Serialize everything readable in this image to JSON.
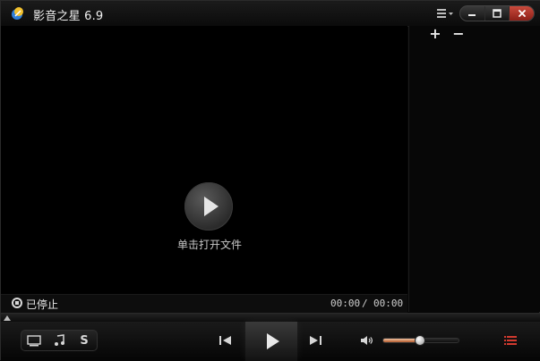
{
  "app": {
    "title": "影音之星 6.9",
    "accent_orange": "#e2762e",
    "accent_red": "#d23a2f"
  },
  "title_controls": {
    "menu_icon": "menu-list-icon",
    "minimize_icon": "minimize-icon",
    "maximize_icon": "maximize-icon",
    "close_icon": "close-icon"
  },
  "video": {
    "center_label": "单击打开文件"
  },
  "playlist": {
    "add_label": "+",
    "remove_label": "−"
  },
  "status": {
    "state_text": "已停止",
    "time_current": "00:00",
    "time_separator": "/",
    "time_total": "00:00"
  },
  "controls": {
    "mode_buttons": [
      {
        "icon": "screen-mode-icon"
      },
      {
        "icon": "music-note-icon"
      },
      {
        "label": "S"
      }
    ],
    "volume_fraction": 0.48
  }
}
